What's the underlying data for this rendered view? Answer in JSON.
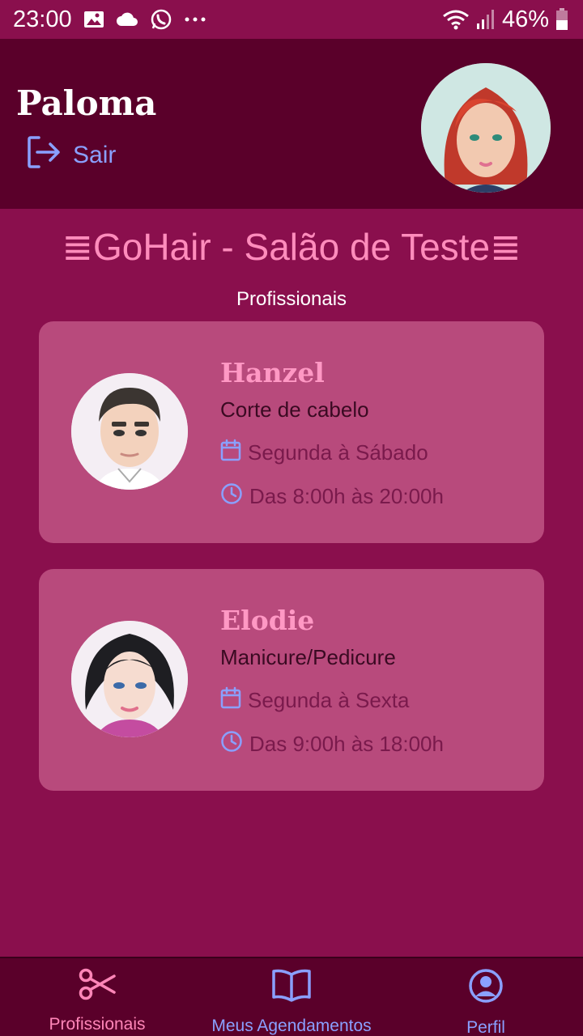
{
  "status_bar": {
    "time": "23:00",
    "battery": "46%"
  },
  "header": {
    "user_name": "Paloma",
    "logout_label": "Sair"
  },
  "salon": {
    "title": "≣GoHair - Salão de Teste≣",
    "section_label": "Profissionais"
  },
  "professionals": [
    {
      "name": "Hanzel",
      "service": "Corte de cabelo",
      "days": "Segunda à Sábado",
      "hours": "Das 8:00h às 20:00h"
    },
    {
      "name": "Elodie",
      "service": "Manicure/Pedicure",
      "days": "Segunda à Sexta",
      "hours": "Das 9:00h às 18:00h"
    }
  ],
  "bottom_nav": {
    "items": [
      {
        "label": "Profissionais",
        "icon": "scissors-icon"
      },
      {
        "label": "Meus Agendamentos",
        "icon": "book-icon"
      },
      {
        "label": "Perfil",
        "icon": "user-circle-icon"
      }
    ]
  },
  "colors": {
    "background": "#8a0f4d",
    "header": "#5a002a",
    "card": "#b84a7c",
    "accent_pink": "#ff8cbc",
    "accent_blue": "#8aa0ff"
  }
}
